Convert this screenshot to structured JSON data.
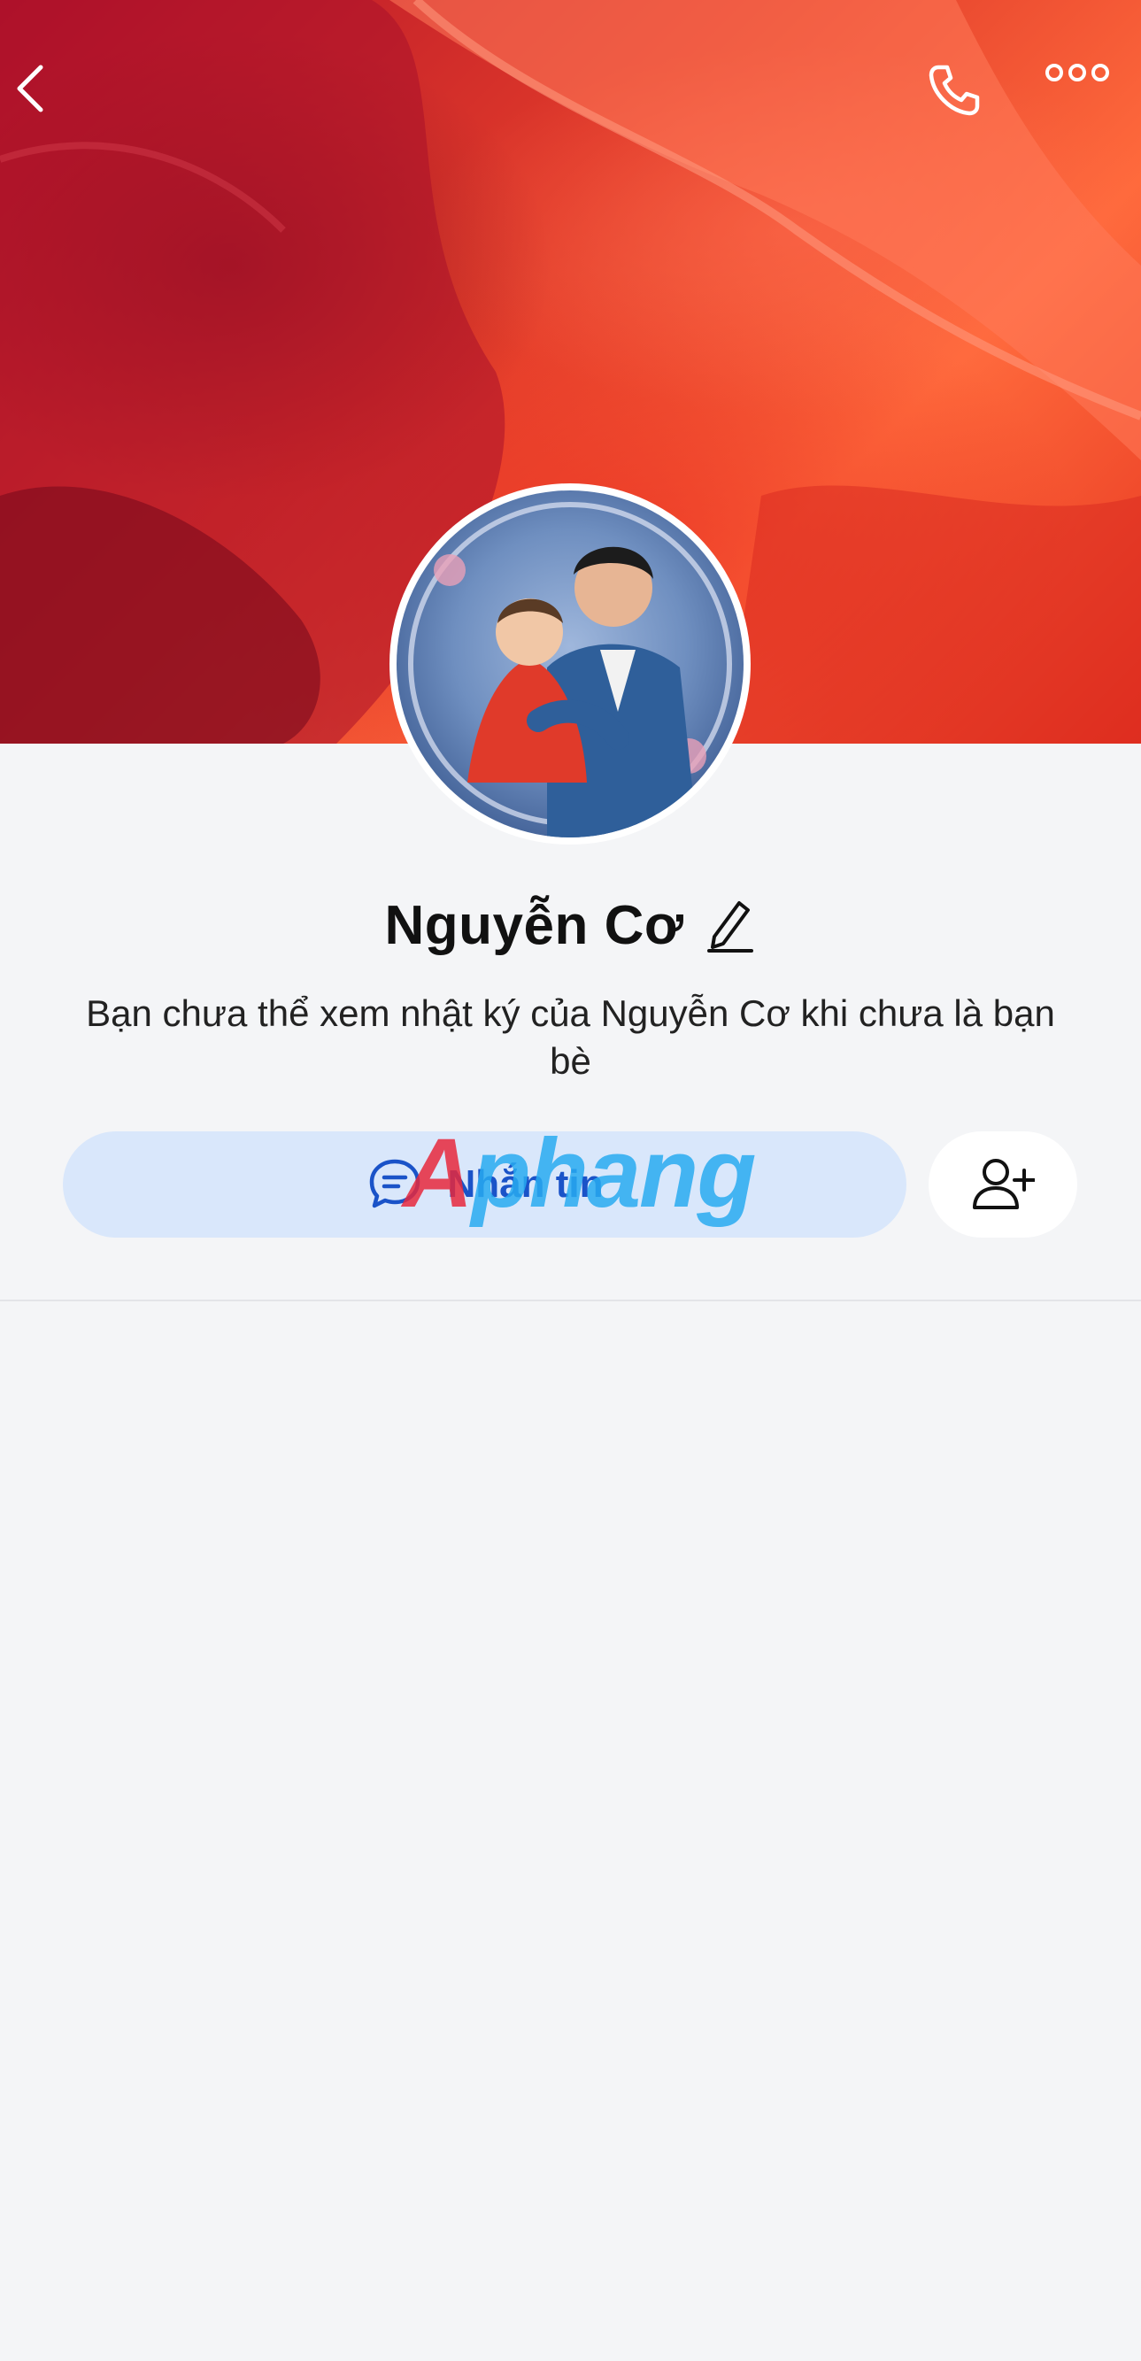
{
  "header": {
    "back_icon": "chevron-left-icon",
    "call_icon": "phone-icon",
    "more_icon": "more-horizontal-icon"
  },
  "profile": {
    "name": "Nguyễn Cơ",
    "edit_icon": "pencil-icon",
    "notice": "Bạn chưa thể xem nhật ký của Nguyễn Cơ khi chưa là bạn bè"
  },
  "actions": {
    "message_label": "Nhắn tin",
    "message_icon": "chat-bubble-icon",
    "add_friend_icon": "user-plus-icon"
  },
  "watermark": {
    "first": "A",
    "rest": "phang"
  },
  "colors": {
    "accent": "#1a53c8",
    "message_button_bg": "#d9e7fb",
    "page_bg": "#f4f5f7"
  }
}
